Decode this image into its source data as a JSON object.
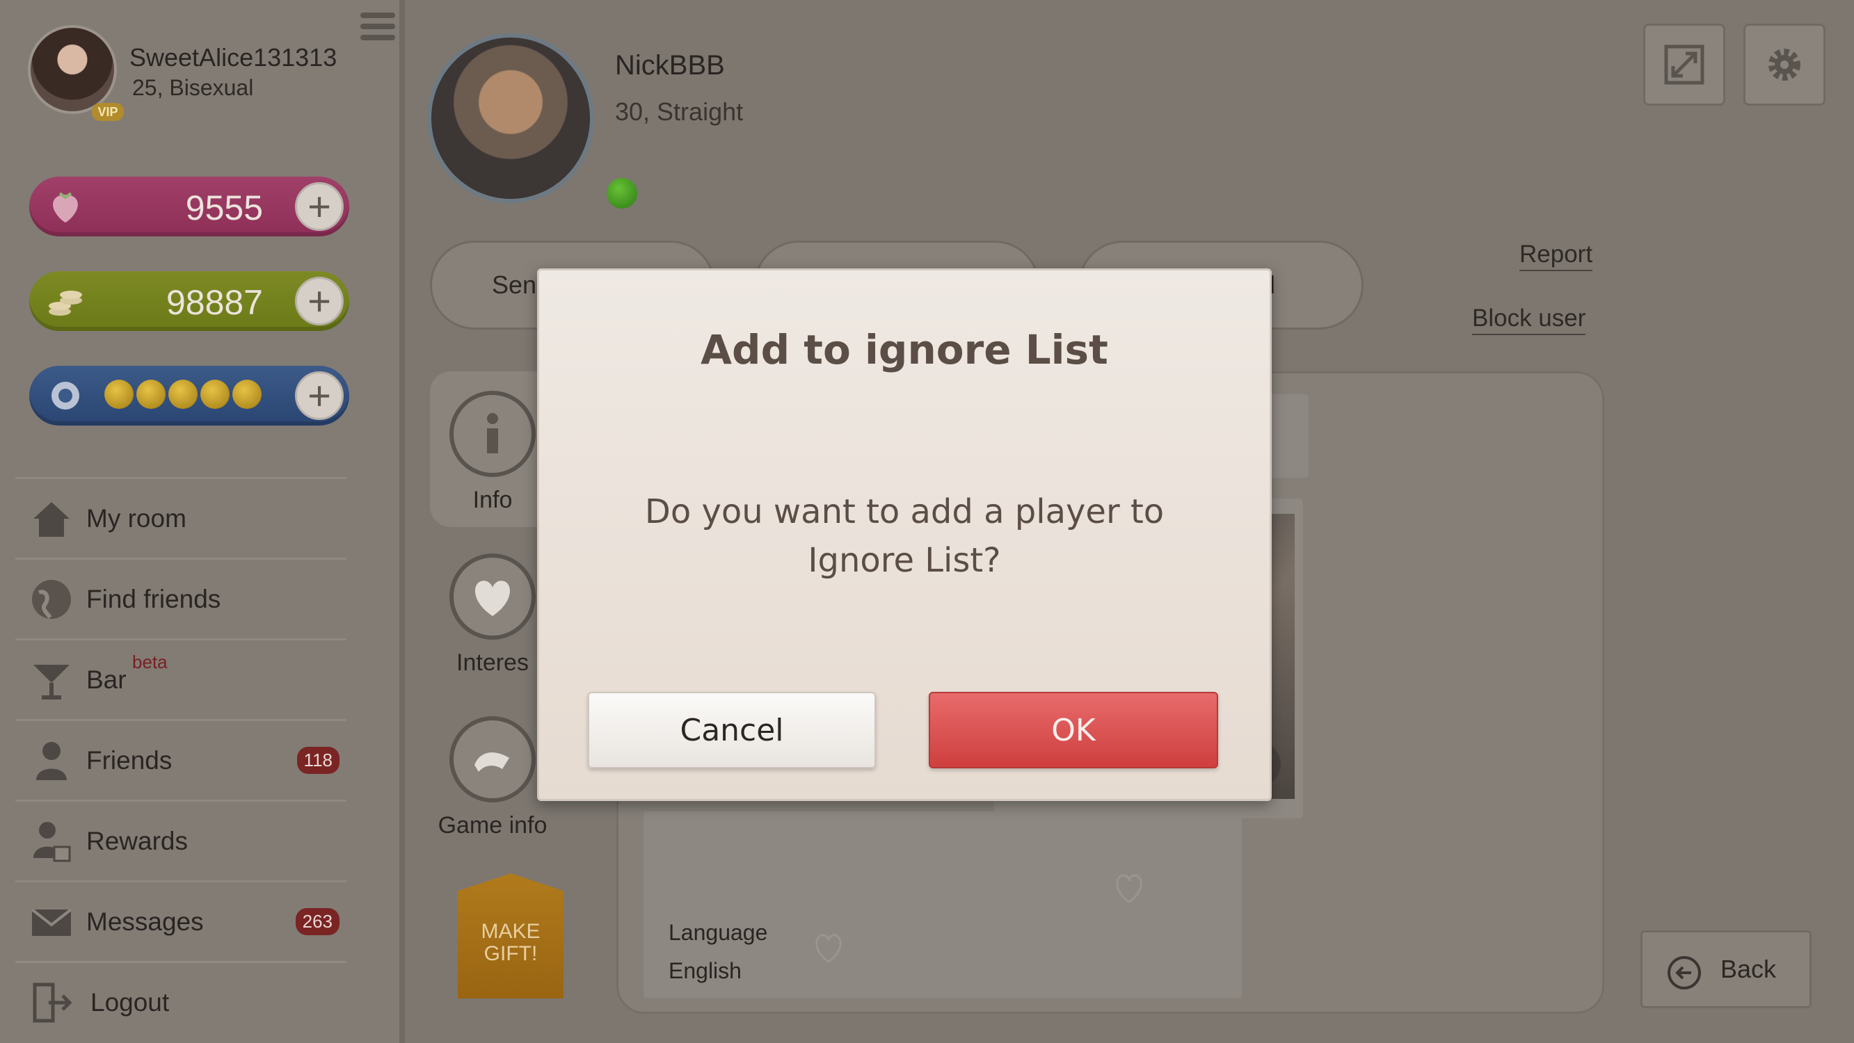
{
  "user": {
    "name": "SweetAlice131313",
    "info": "25, Bisexual",
    "vip_label": "VIP"
  },
  "currencies": {
    "strawberries": "9555",
    "coins": "98887",
    "tokens_filled": 5
  },
  "nav": {
    "items": [
      {
        "label": "My room"
      },
      {
        "label": "Find friends"
      },
      {
        "label": "Bar",
        "tag": "beta"
      },
      {
        "label": "Friends",
        "badge": "118"
      },
      {
        "label": "Rewards"
      },
      {
        "label": "Messages",
        "badge": "263"
      },
      {
        "label": "Logout"
      }
    ]
  },
  "profile": {
    "name": "NickBBB",
    "info": "30, Straight",
    "online": true,
    "photo_count": "1"
  },
  "actions": {
    "send_partial": "Sen",
    "friend_partial": "nd",
    "report": "Report",
    "block": "Block user"
  },
  "tabs": {
    "info": "Info",
    "interests": "Interes",
    "game_info": "Game info",
    "make_gift": "MAKE GIFT!"
  },
  "details": {
    "language_label": "Language",
    "language_value": "English"
  },
  "back_label": "Back",
  "modal": {
    "title": "Add to ignore List",
    "message": "Do you want to add a player to Ignore List?",
    "cancel": "Cancel",
    "ok": "OK"
  },
  "colors": {
    "ok_button": "#d94a4a",
    "overlay": "#7d7770",
    "online": "#3f9a20"
  }
}
